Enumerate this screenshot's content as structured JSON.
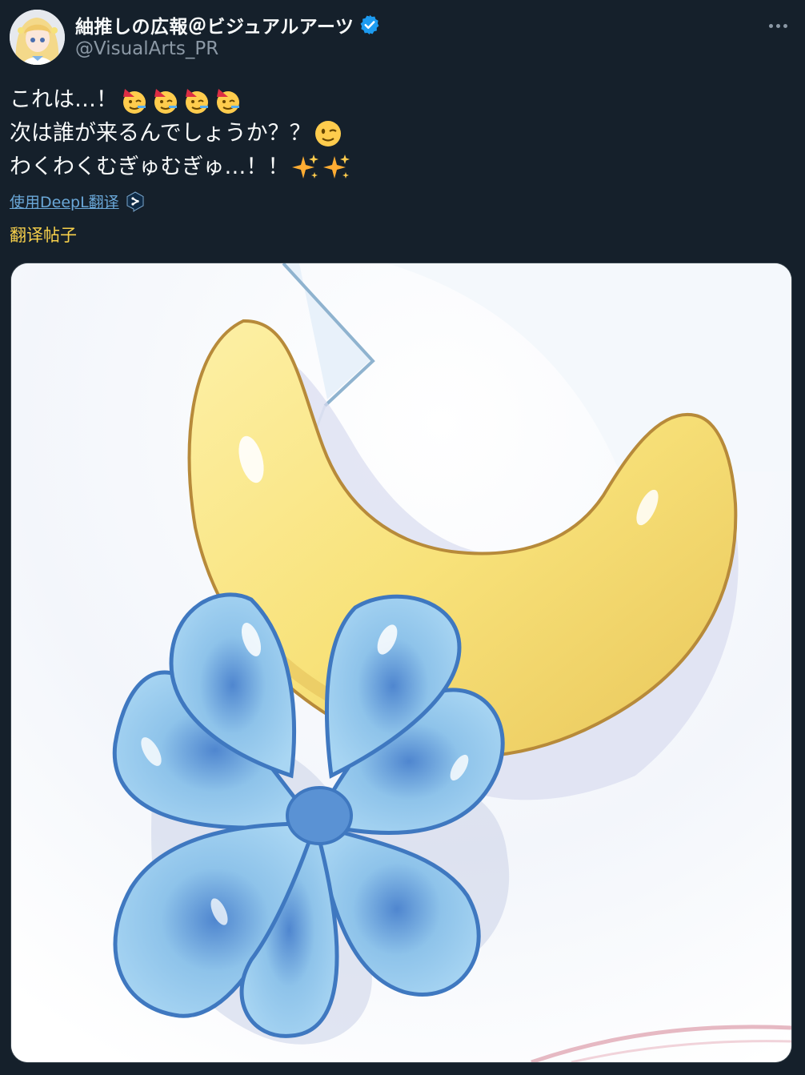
{
  "author": {
    "display_name": "紬推しの広報＠ビジュアルアーツ",
    "handle": "@VisualArts_PR",
    "verified": true,
    "avatar_icon": "anime-avatar-icon"
  },
  "more_button_icon": "more-horizontal-icon",
  "tweet": {
    "line1": "これは…！",
    "line2": "次は誰が来るんでしょうか？？",
    "line3": "わくわくむぎゅむぎゅ…！！",
    "line1_emoji": [
      "partying-face-icon",
      "partying-face-icon",
      "partying-face-icon",
      "partying-face-icon"
    ],
    "line2_emoji": [
      "winking-face-icon"
    ],
    "line3_emoji": [
      "sparkles-icon",
      "sparkles-icon"
    ]
  },
  "translate": {
    "deepl_label": "使用DeepL翻译",
    "deepl_icon": "deepl-icon",
    "post_label": "翻译帖子"
  },
  "media": {
    "image_icon": "crescent-moon-with-blue-bow-illustration"
  },
  "colors": {
    "background": "#15202b",
    "text": "#f7f9f9",
    "secondary_text": "#8b98a5",
    "link": "#6aa8d9",
    "translate_post": "#f8d14b",
    "verified_badge": "#1d9bf0"
  }
}
